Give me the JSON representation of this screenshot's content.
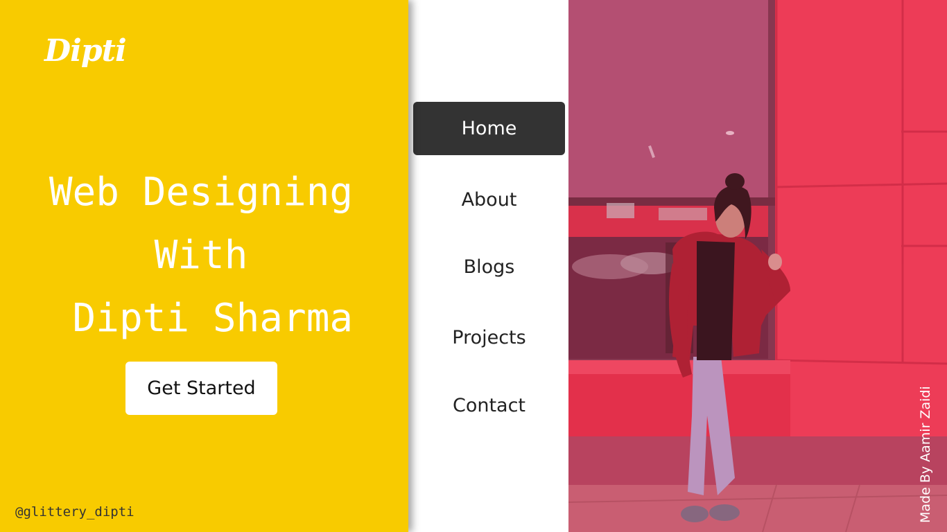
{
  "brand": {
    "logo_text": "Dipti"
  },
  "hero": {
    "line1": "Web Designing",
    "line2": "With",
    "line3": " Dipti Sharma",
    "cta_label": "Get Started"
  },
  "footer": {
    "handle": "@glittery_dipti"
  },
  "nav": {
    "items": [
      {
        "label": "Home",
        "active": true
      },
      {
        "label": "About",
        "active": false
      },
      {
        "label": "Blogs",
        "active": false
      },
      {
        "label": "Projects",
        "active": false
      },
      {
        "label": "Contact",
        "active": false
      }
    ]
  },
  "photo": {
    "credit": "Made By Aamir Zaidi"
  },
  "colors": {
    "accent_yellow": "#f8cb00",
    "nav_active_bg": "#333333",
    "photo_overlay": "#e8344f"
  }
}
